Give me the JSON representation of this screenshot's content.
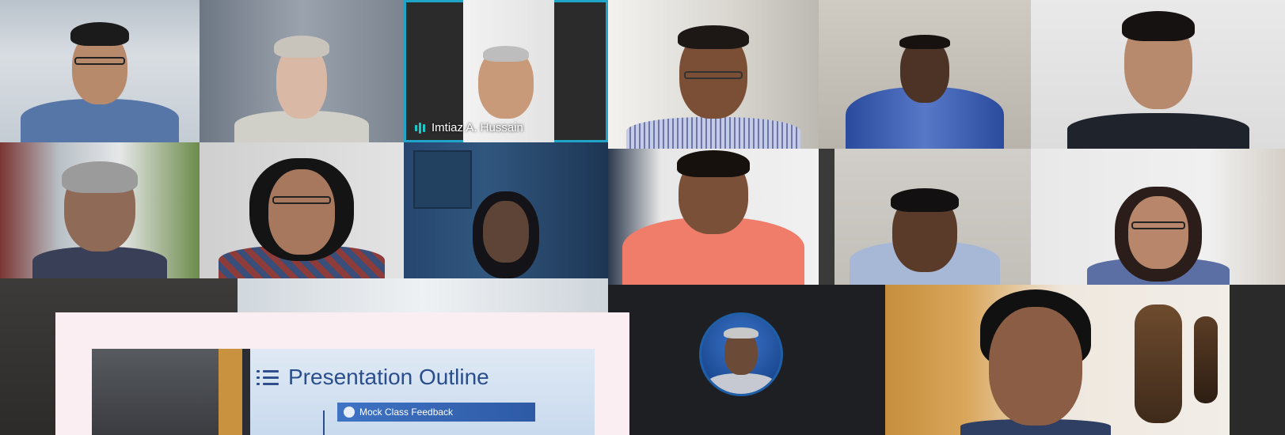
{
  "meeting": {
    "active_speaker": {
      "name": "Imtiaz A. Hussain",
      "indicator": "audio-wave-icon"
    },
    "shared_screen": {
      "slide_title": "Presentation Outline",
      "slide_item": "Mock Class Feedback",
      "title_icon": "list-icon",
      "item_icon": "smiley-icon"
    },
    "colors": {
      "speaker_highlight": "#1ea5c8",
      "slide_title": "#2a4e8d",
      "slide_item_bg": "#3f73c4"
    }
  }
}
